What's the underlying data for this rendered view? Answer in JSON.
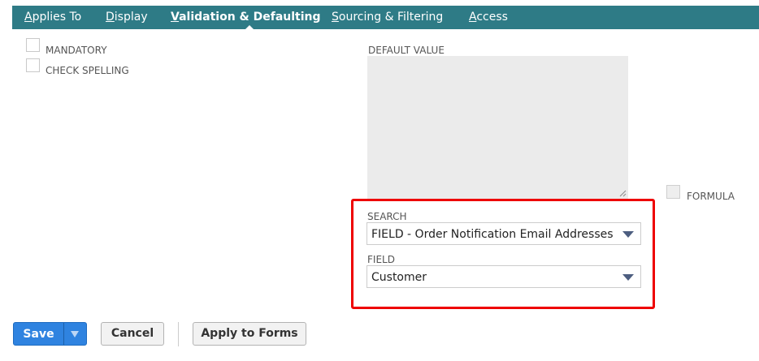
{
  "tabs": [
    {
      "prefix": "",
      "accel": "A",
      "rest": "pplies To"
    },
    {
      "prefix": "",
      "accel": "D",
      "rest": "isplay"
    },
    {
      "prefix": "",
      "accel": "V",
      "rest": "alidation & Defaulting"
    },
    {
      "prefix": "",
      "accel": "S",
      "rest": "ourcing & Filtering"
    },
    {
      "prefix": "",
      "accel": "A",
      "rest": "ccess"
    }
  ],
  "active_tab": "Validation & Defaulting",
  "checkboxes": {
    "mandatory": "MANDATORY",
    "check_spelling": "CHECK SPELLING",
    "formula": "FORMULA"
  },
  "default_value": {
    "label": "DEFAULT VALUE",
    "value": ""
  },
  "search": {
    "label": "SEARCH",
    "value": "FIELD - Order Notification Email Addresses"
  },
  "field": {
    "label": "FIELD",
    "value": "Customer"
  },
  "buttons": {
    "save": "Save",
    "cancel": "Cancel",
    "apply_to_forms": "Apply to Forms"
  },
  "colors": {
    "tabbar": "#2e7b86",
    "save": "#2f83e0",
    "highlight": "#ee0000"
  }
}
